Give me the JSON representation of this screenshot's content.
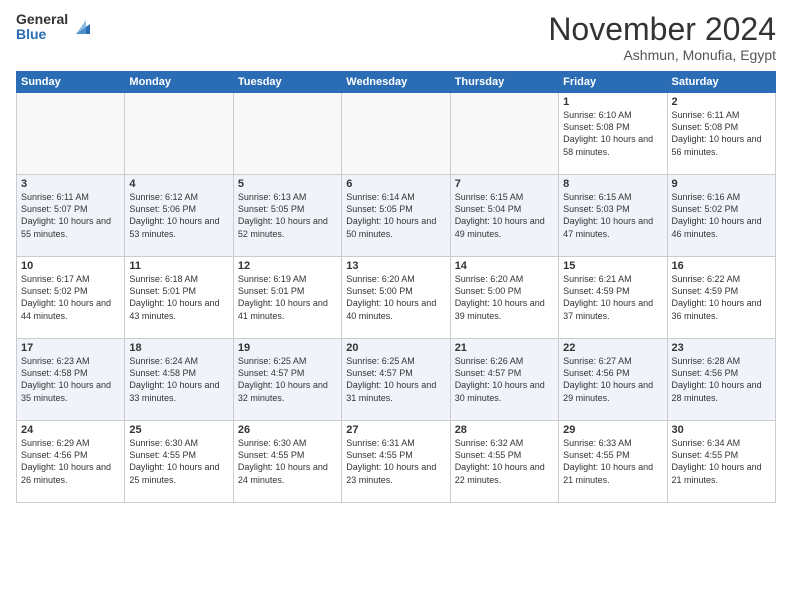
{
  "header": {
    "logo_general": "General",
    "logo_blue": "Blue",
    "month_title": "November 2024",
    "location": "Ashmun, Monufia, Egypt"
  },
  "days_of_week": [
    "Sunday",
    "Monday",
    "Tuesday",
    "Wednesday",
    "Thursday",
    "Friday",
    "Saturday"
  ],
  "weeks": [
    [
      {
        "day": "",
        "sunrise": "",
        "sunset": "",
        "daylight": ""
      },
      {
        "day": "",
        "sunrise": "",
        "sunset": "",
        "daylight": ""
      },
      {
        "day": "",
        "sunrise": "",
        "sunset": "",
        "daylight": ""
      },
      {
        "day": "",
        "sunrise": "",
        "sunset": "",
        "daylight": ""
      },
      {
        "day": "",
        "sunrise": "",
        "sunset": "",
        "daylight": ""
      },
      {
        "day": "1",
        "sunrise": "Sunrise: 6:10 AM",
        "sunset": "Sunset: 5:08 PM",
        "daylight": "Daylight: 10 hours and 58 minutes."
      },
      {
        "day": "2",
        "sunrise": "Sunrise: 6:11 AM",
        "sunset": "Sunset: 5:08 PM",
        "daylight": "Daylight: 10 hours and 56 minutes."
      }
    ],
    [
      {
        "day": "3",
        "sunrise": "Sunrise: 6:11 AM",
        "sunset": "Sunset: 5:07 PM",
        "daylight": "Daylight: 10 hours and 55 minutes."
      },
      {
        "day": "4",
        "sunrise": "Sunrise: 6:12 AM",
        "sunset": "Sunset: 5:06 PM",
        "daylight": "Daylight: 10 hours and 53 minutes."
      },
      {
        "day": "5",
        "sunrise": "Sunrise: 6:13 AM",
        "sunset": "Sunset: 5:05 PM",
        "daylight": "Daylight: 10 hours and 52 minutes."
      },
      {
        "day": "6",
        "sunrise": "Sunrise: 6:14 AM",
        "sunset": "Sunset: 5:05 PM",
        "daylight": "Daylight: 10 hours and 50 minutes."
      },
      {
        "day": "7",
        "sunrise": "Sunrise: 6:15 AM",
        "sunset": "Sunset: 5:04 PM",
        "daylight": "Daylight: 10 hours and 49 minutes."
      },
      {
        "day": "8",
        "sunrise": "Sunrise: 6:15 AM",
        "sunset": "Sunset: 5:03 PM",
        "daylight": "Daylight: 10 hours and 47 minutes."
      },
      {
        "day": "9",
        "sunrise": "Sunrise: 6:16 AM",
        "sunset": "Sunset: 5:02 PM",
        "daylight": "Daylight: 10 hours and 46 minutes."
      }
    ],
    [
      {
        "day": "10",
        "sunrise": "Sunrise: 6:17 AM",
        "sunset": "Sunset: 5:02 PM",
        "daylight": "Daylight: 10 hours and 44 minutes."
      },
      {
        "day": "11",
        "sunrise": "Sunrise: 6:18 AM",
        "sunset": "Sunset: 5:01 PM",
        "daylight": "Daylight: 10 hours and 43 minutes."
      },
      {
        "day": "12",
        "sunrise": "Sunrise: 6:19 AM",
        "sunset": "Sunset: 5:01 PM",
        "daylight": "Daylight: 10 hours and 41 minutes."
      },
      {
        "day": "13",
        "sunrise": "Sunrise: 6:20 AM",
        "sunset": "Sunset: 5:00 PM",
        "daylight": "Daylight: 10 hours and 40 minutes."
      },
      {
        "day": "14",
        "sunrise": "Sunrise: 6:20 AM",
        "sunset": "Sunset: 5:00 PM",
        "daylight": "Daylight: 10 hours and 39 minutes."
      },
      {
        "day": "15",
        "sunrise": "Sunrise: 6:21 AM",
        "sunset": "Sunset: 4:59 PM",
        "daylight": "Daylight: 10 hours and 37 minutes."
      },
      {
        "day": "16",
        "sunrise": "Sunrise: 6:22 AM",
        "sunset": "Sunset: 4:59 PM",
        "daylight": "Daylight: 10 hours and 36 minutes."
      }
    ],
    [
      {
        "day": "17",
        "sunrise": "Sunrise: 6:23 AM",
        "sunset": "Sunset: 4:58 PM",
        "daylight": "Daylight: 10 hours and 35 minutes."
      },
      {
        "day": "18",
        "sunrise": "Sunrise: 6:24 AM",
        "sunset": "Sunset: 4:58 PM",
        "daylight": "Daylight: 10 hours and 33 minutes."
      },
      {
        "day": "19",
        "sunrise": "Sunrise: 6:25 AM",
        "sunset": "Sunset: 4:57 PM",
        "daylight": "Daylight: 10 hours and 32 minutes."
      },
      {
        "day": "20",
        "sunrise": "Sunrise: 6:25 AM",
        "sunset": "Sunset: 4:57 PM",
        "daylight": "Daylight: 10 hours and 31 minutes."
      },
      {
        "day": "21",
        "sunrise": "Sunrise: 6:26 AM",
        "sunset": "Sunset: 4:57 PM",
        "daylight": "Daylight: 10 hours and 30 minutes."
      },
      {
        "day": "22",
        "sunrise": "Sunrise: 6:27 AM",
        "sunset": "Sunset: 4:56 PM",
        "daylight": "Daylight: 10 hours and 29 minutes."
      },
      {
        "day": "23",
        "sunrise": "Sunrise: 6:28 AM",
        "sunset": "Sunset: 4:56 PM",
        "daylight": "Daylight: 10 hours and 28 minutes."
      }
    ],
    [
      {
        "day": "24",
        "sunrise": "Sunrise: 6:29 AM",
        "sunset": "Sunset: 4:56 PM",
        "daylight": "Daylight: 10 hours and 26 minutes."
      },
      {
        "day": "25",
        "sunrise": "Sunrise: 6:30 AM",
        "sunset": "Sunset: 4:55 PM",
        "daylight": "Daylight: 10 hours and 25 minutes."
      },
      {
        "day": "26",
        "sunrise": "Sunrise: 6:30 AM",
        "sunset": "Sunset: 4:55 PM",
        "daylight": "Daylight: 10 hours and 24 minutes."
      },
      {
        "day": "27",
        "sunrise": "Sunrise: 6:31 AM",
        "sunset": "Sunset: 4:55 PM",
        "daylight": "Daylight: 10 hours and 23 minutes."
      },
      {
        "day": "28",
        "sunrise": "Sunrise: 6:32 AM",
        "sunset": "Sunset: 4:55 PM",
        "daylight": "Daylight: 10 hours and 22 minutes."
      },
      {
        "day": "29",
        "sunrise": "Sunrise: 6:33 AM",
        "sunset": "Sunset: 4:55 PM",
        "daylight": "Daylight: 10 hours and 21 minutes."
      },
      {
        "day": "30",
        "sunrise": "Sunrise: 6:34 AM",
        "sunset": "Sunset: 4:55 PM",
        "daylight": "Daylight: 10 hours and 21 minutes."
      }
    ]
  ]
}
